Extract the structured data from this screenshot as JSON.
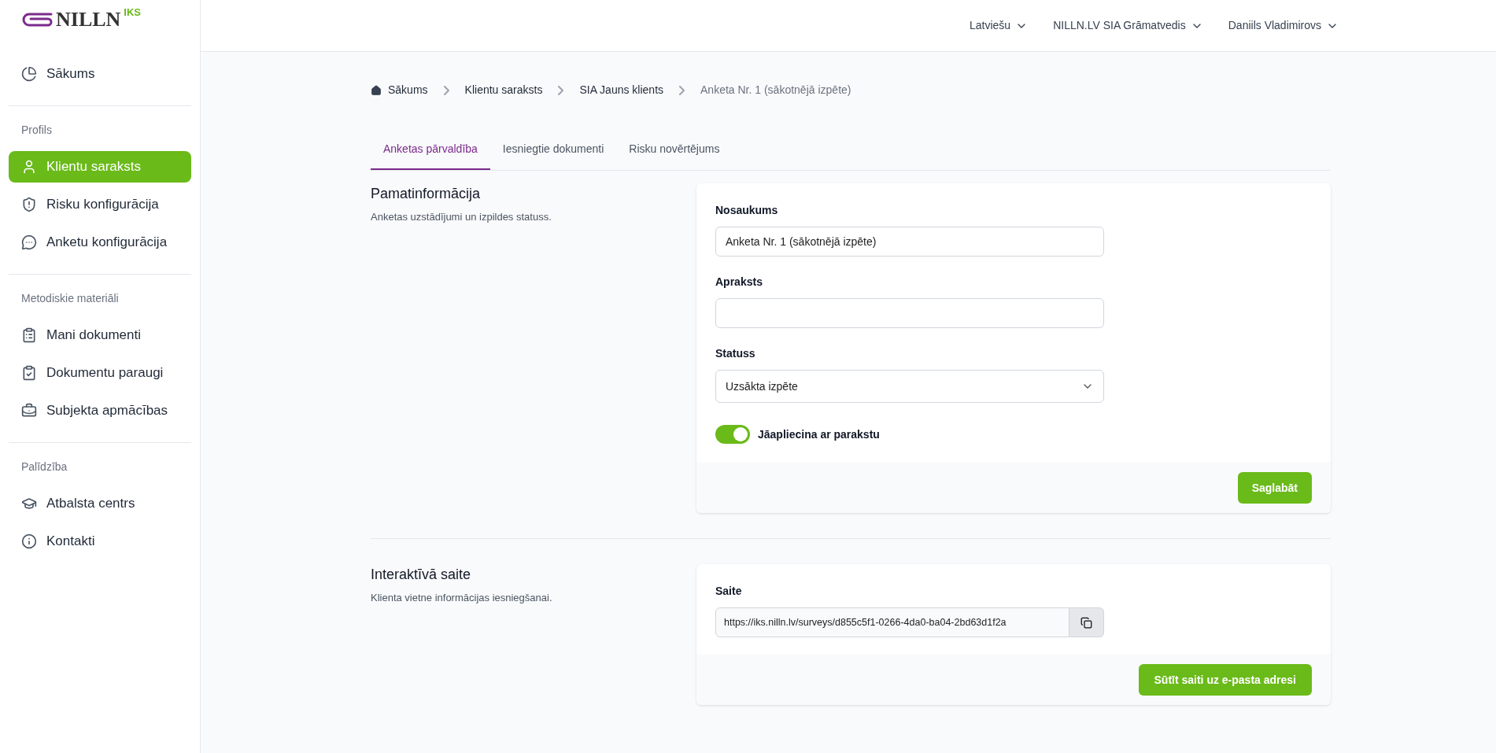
{
  "logo": {
    "text": "NILLN",
    "sup": "IKS"
  },
  "header": {
    "menus": [
      "Latviešu",
      "NILLN.LV SIA Grāmatvedis",
      "Daniils Vladimirovs"
    ]
  },
  "sidebar": {
    "groups": [
      {
        "items": [
          {
            "label": "Sākums",
            "selected": false
          }
        ]
      },
      {
        "title": "Profils",
        "items": [
          {
            "label": "Klientu saraksts",
            "selected": true
          },
          {
            "label": "Risku konfigurācija",
            "selected": false
          },
          {
            "label": "Anketu konfigurācija",
            "selected": false
          }
        ]
      },
      {
        "title": "Metodiskie materiāli",
        "items": [
          {
            "label": "Mani dokumenti",
            "selected": false
          },
          {
            "label": "Dokumentu paraugi",
            "selected": false
          },
          {
            "label": "Subjekta apmācības",
            "selected": false
          }
        ]
      },
      {
        "title": "Palīdzība",
        "items": [
          {
            "label": "Atbalsta centrs",
            "selected": false
          },
          {
            "label": "Kontakti",
            "selected": false
          }
        ]
      }
    ]
  },
  "breadcrumb": [
    "Sākums",
    "Klientu saraksts",
    "SIA Jauns klients",
    "Anketa Nr. 1 (sākotnējā izpēte)"
  ],
  "tabs": [
    {
      "label": "Anketas pārvaldība",
      "selected": true
    },
    {
      "label": "Iesniegtie dokumenti",
      "selected": false
    },
    {
      "label": "Risku novērtējums",
      "selected": false
    }
  ],
  "basic": {
    "title": "Pamatinformācija",
    "description": "Anketas uzstādījumi un izpildes statuss.",
    "fields": [
      {
        "kind": "text",
        "label": "Nosaukums",
        "value": "Anketa Nr. 1 (sākotnējā izpēte)"
      },
      {
        "kind": "text",
        "label": "Apraksts"
      },
      {
        "kind": "select",
        "label": "Statuss",
        "value": "Uzsākta izpēte"
      }
    ],
    "toggle": {
      "label": "Jāapliecina ar parakstu",
      "on": true
    },
    "button": "Saglabāt"
  },
  "link": {
    "title": "Interaktīvā saite",
    "description": "Klienta vietne informācijas iesniegšanai.",
    "label": "Saite",
    "value": "https://iks.nilln.lv/surveys/d855c5f1-0266-4da0-ba04-2bd63d1f2a",
    "button": "Sūtīt saiti uz e-pasta adresi"
  }
}
